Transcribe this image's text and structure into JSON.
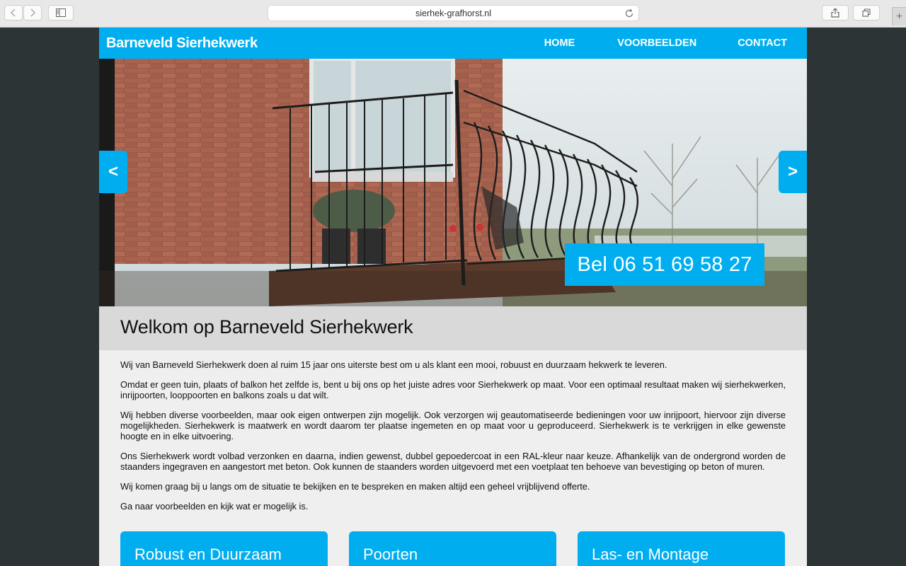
{
  "browser": {
    "url": "sierhek-grafhorst.nl"
  },
  "site": {
    "brand": "Barneveld Sierhekwerk",
    "nav": [
      {
        "label": "HOME"
      },
      {
        "label": "VOORBEELDEN"
      },
      {
        "label": "CONTACT"
      }
    ],
    "slider": {
      "prev_label": "<",
      "next_label": ">",
      "call_text": "Bel 06 51 69 58 27"
    },
    "welcome_title": "Welkom op Barneveld Sierhekwerk",
    "paragraphs": [
      "Wij van Barneveld Sierhekwerk doen al ruim 15 jaar ons uiterste best om u als klant een mooi, robuust en duurzaam hekwerk te leveren.",
      "Omdat er geen tuin, plaats of balkon het zelfde is, bent u bij ons op het juiste adres voor Sierhekwerk op maat. Voor een optimaal resultaat maken wij sierhekwerken, inrijpoorten, looppoorten en balkons zoals u dat wilt.",
      "Wij hebben diverse voorbeelden, maar ook eigen ontwerpen zijn mogelijk. Ook verzorgen wij geautomatiseerde bedieningen voor uw inrijpoort, hiervoor zijn diverse mogelijkheden. Sierhekwerk is maatwerk en wordt daarom ter plaatse ingemeten en op maat voor u geproduceerd. Sierhekwerk is te verkrijgen in elke gewenste hoogte en in elke uitvoering.",
      "Ons Sierhekwerk wordt volbad verzonken en daarna, indien gewenst, dubbel gepoedercoat in een RAL-kleur naar keuze. Afhankelijk van de ondergrond worden de staanders ingegraven en aangestort met beton. Ook kunnen de staanders worden uitgevoerd met een voetplaat ten behoeve van bevestiging op beton of muren.",
      "Wij komen graag bij u langs om de situatie te bekijken en te bespreken en maken altijd een geheel vrijblijvend offerte.",
      "Ga naar voorbeelden en kijk wat er mogelijk is."
    ],
    "cards": [
      {
        "title": "Robust en Duurzaam"
      },
      {
        "title": "Poorten"
      },
      {
        "title": "Las- en Montage"
      }
    ],
    "colors": {
      "accent": "#00aeef",
      "page_bg": "#2c3436",
      "content_bg": "#efefef"
    }
  }
}
